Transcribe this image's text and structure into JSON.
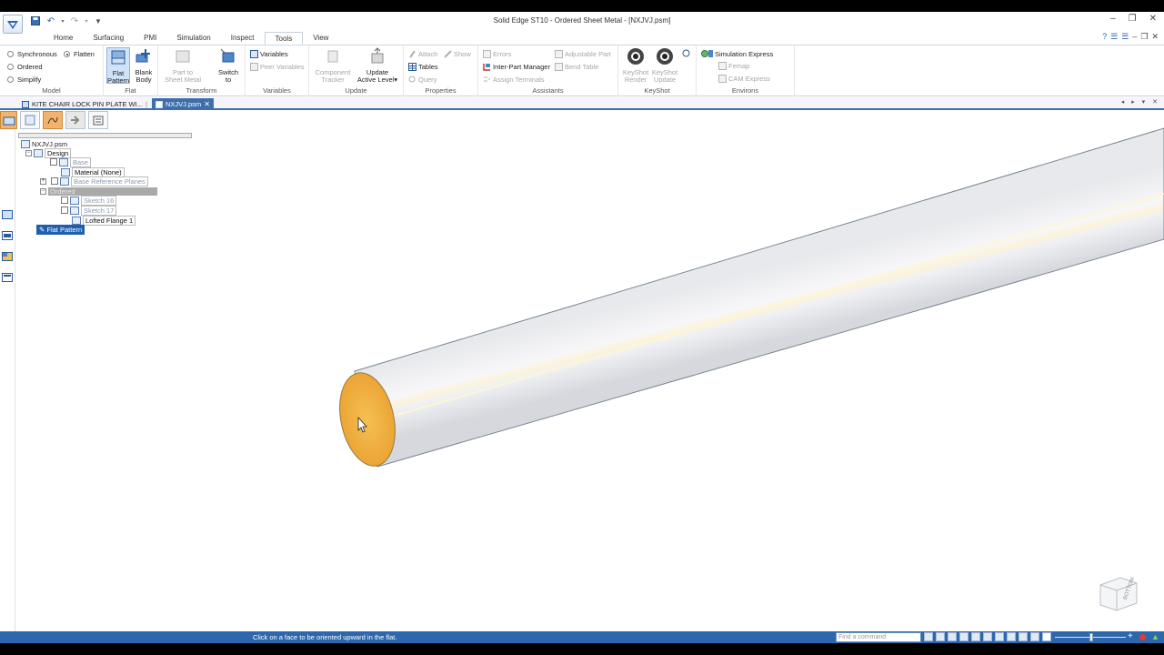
{
  "window": {
    "title": "Solid Edge ST10 - Ordered Sheet Metal - [NXJVJ.psm]",
    "controls": [
      "minimize-icon",
      "restore-icon",
      "close-icon"
    ]
  },
  "quick_access": [
    "save-icon",
    "undo-icon",
    "redo-icon",
    "customize-icon"
  ],
  "ribbon_tabs": [
    "Home",
    "Surfacing",
    "PMI",
    "Simulation",
    "Inspect",
    "Tools",
    "View"
  ],
  "active_tab": "Tools",
  "ribbon": {
    "model": {
      "label": "Model",
      "synchronous": "Synchronous",
      "flatten": "Flatten",
      "ordered": "Ordered",
      "simplify": "Simplify"
    },
    "flat": {
      "label": "Flat",
      "flat_pattern": [
        "Flat",
        "Pattern"
      ],
      "blank_body": [
        "Blank",
        "Body"
      ]
    },
    "transform": {
      "label": "Transform",
      "part_to_sheet_metal": [
        "Part to",
        "Sheet Metal"
      ],
      "switch_to": [
        "Switch",
        "to"
      ]
    },
    "variables": {
      "label": "Variables",
      "variables": "Variables",
      "peer_variables": "Peer Variables"
    },
    "update": {
      "label": "Update",
      "component_tracker": [
        "Component",
        "Tracker"
      ],
      "update_active_level": [
        "Update",
        "Active Level"
      ]
    },
    "properties": {
      "label": "Properties",
      "attach": "Attach",
      "show": "Show",
      "tables": "Tables",
      "query": "Query"
    },
    "assistants": {
      "label": "Assistants",
      "errors": "Errors",
      "adjustable_part": "Adjustable Part",
      "inter_part_manager": "Inter-Part Manager",
      "bend_table": "Bend Table",
      "assign_terminals": "Assign Terminals"
    },
    "keyshot": {
      "label": "KeyShot",
      "render": [
        "KeyShot",
        "Render"
      ],
      "update": [
        "KeyShot",
        "Update"
      ]
    },
    "environs": {
      "label": "Environs",
      "simulation_express": "Simulation Express",
      "femap": "Femap",
      "cam_express": "CAM Express"
    }
  },
  "doc_tabs": [
    {
      "label": "KITE CHAIR LOCK PIN PLATE WI...",
      "active": false
    },
    {
      "label": "NXJVJ.psm",
      "active": true
    }
  ],
  "tree": {
    "root": "NXJVJ.psm",
    "design": "Design",
    "base": "Base",
    "material": "Material (None)",
    "base_ref_planes": "Base Reference Planes",
    "ordered": "Ordered",
    "sketch16": "Sketch 16",
    "sketch17": "Sketch 17",
    "lofted_flange": "Lofted Flange 1",
    "flat_pattern": "Flat Pattern"
  },
  "viewcube_label": "BOTTOM",
  "status": {
    "prompt": "Click on a face to be oriented upward in the flat.",
    "find_placeholder": "Find a command"
  },
  "colors": {
    "accent": "#2d67ad",
    "face_highlight": "#f0b340",
    "body": "#eceef2"
  }
}
